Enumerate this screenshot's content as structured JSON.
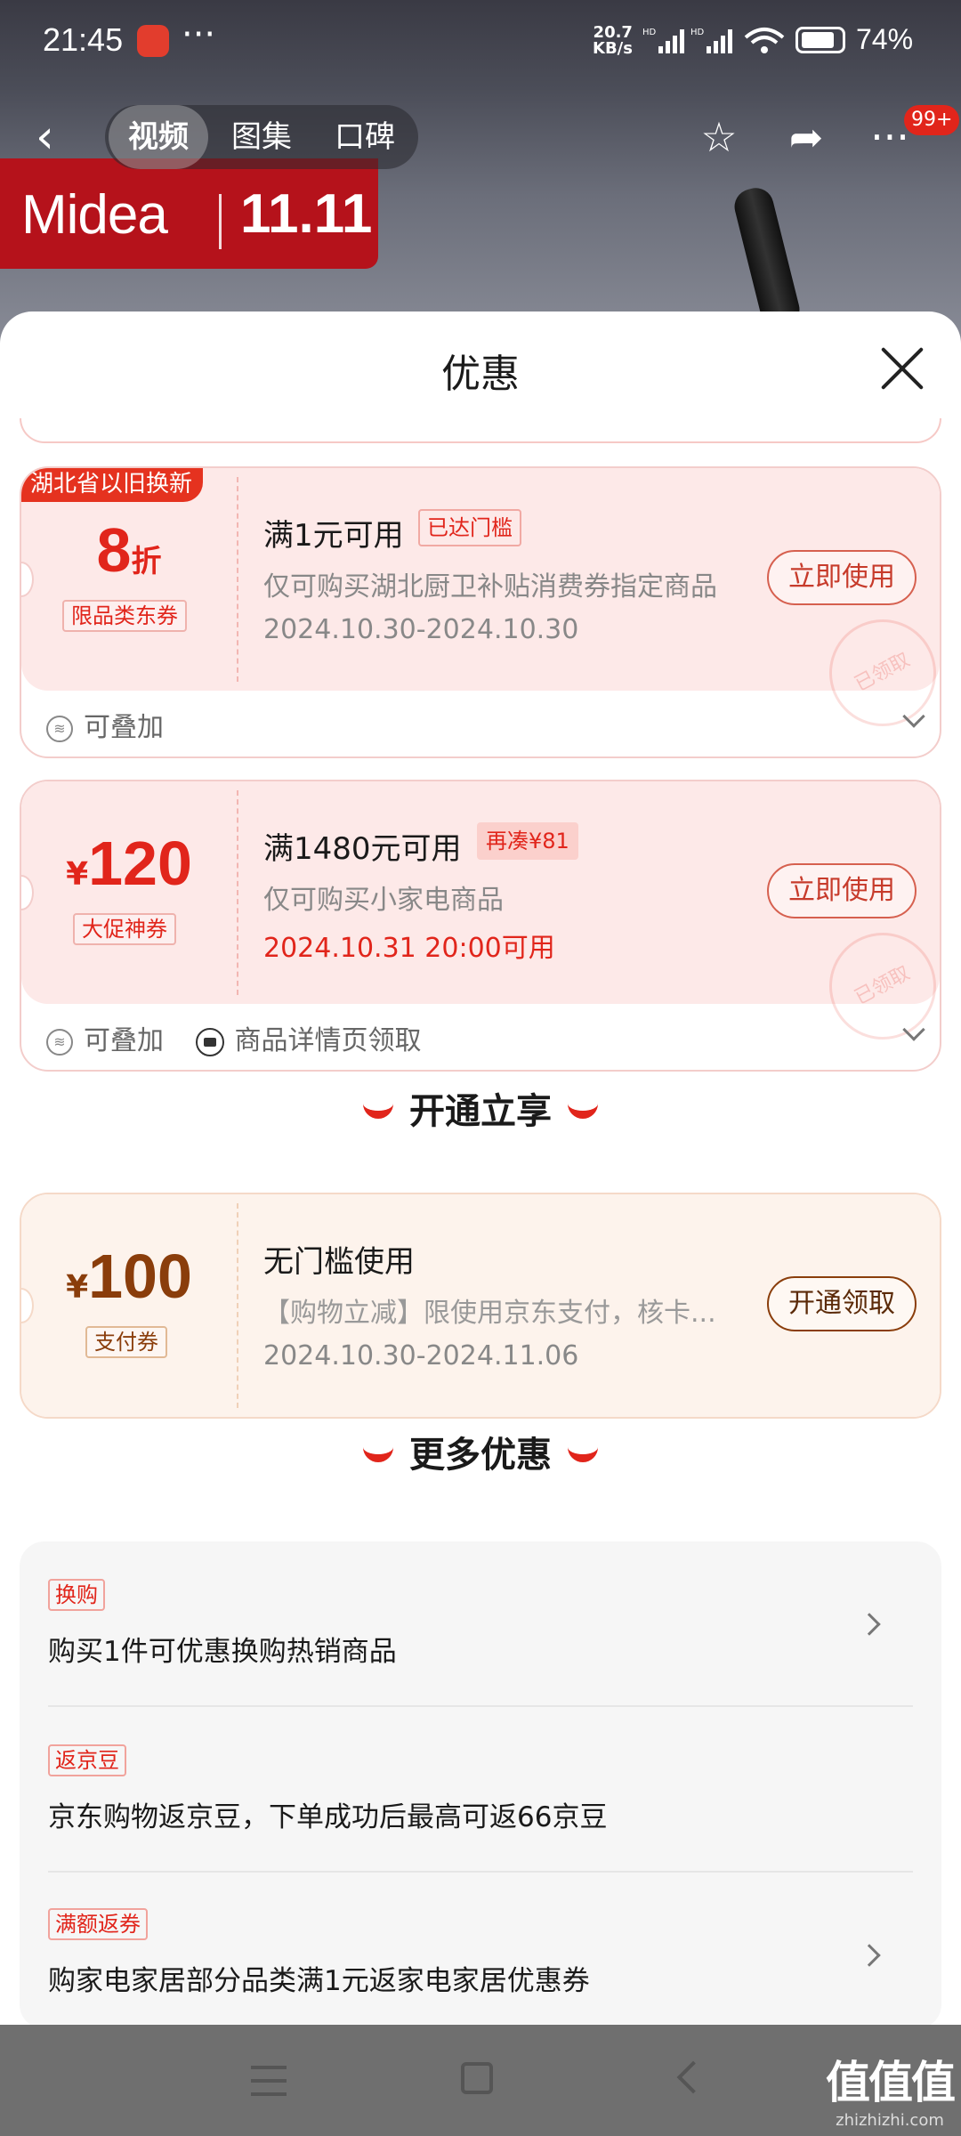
{
  "status_bar": {
    "time": "21:45",
    "network_speed_value": "20.7",
    "network_speed_unit": "KB/s",
    "signal_label": "HD",
    "battery": "74%"
  },
  "top_nav": {
    "tabs": [
      "视频",
      "图集",
      "口碑"
    ],
    "active_tab": "视频",
    "badge": "99+"
  },
  "banner": {
    "brand": "Midea",
    "event": "11.11"
  },
  "sheet": {
    "title": "优惠",
    "coupons": [
      {
        "ribbon": "湖北省以旧换新",
        "amount": "8",
        "amount_unit": "折",
        "tag": "限品类东券",
        "title": "满1元可用",
        "pill": "已达门槛",
        "desc": "仅可购买湖北厨卫补贴消费券指定商品",
        "date": "2024.10.30-2024.10.30",
        "button": "立即使用",
        "stamp": "已领取",
        "footer": [
          "可叠加"
        ]
      },
      {
        "currency": "¥",
        "amount": "120",
        "tag": "大促神券",
        "title": "满1480元可用",
        "pill": "再凑¥81",
        "desc": "仅可购买小家电商品",
        "date": "2024.10.31 20:00可用",
        "button": "立即使用",
        "stamp": "已领取",
        "footer": [
          "可叠加",
          "商品详情页领取"
        ]
      }
    ],
    "section_open": "开通立享",
    "open_coupon": {
      "currency": "¥",
      "amount": "100",
      "tag": "支付券",
      "title": "无门槛使用",
      "desc": "【购物立减】限使用京东支付，核卡...",
      "date": "2024.10.30-2024.11.06",
      "button": "开通领取"
    },
    "section_more": "更多优惠",
    "more_items": [
      {
        "tag": "换购",
        "text": "购买1件可优惠换购热销商品"
      },
      {
        "tag": "返京豆",
        "text": "京东购物返京豆，下单成功后最高可返66京豆"
      },
      {
        "tag": "满额返券",
        "text": "购家电家居部分品类满1元返家电家居优惠券"
      }
    ]
  },
  "watermark": {
    "main": "值值值",
    "sub": "zhizhizhi.com"
  },
  "colors": {
    "accent_red": "#e1251b",
    "gold": "#8a3d0b",
    "coupon_bg": "#fde9e8"
  }
}
